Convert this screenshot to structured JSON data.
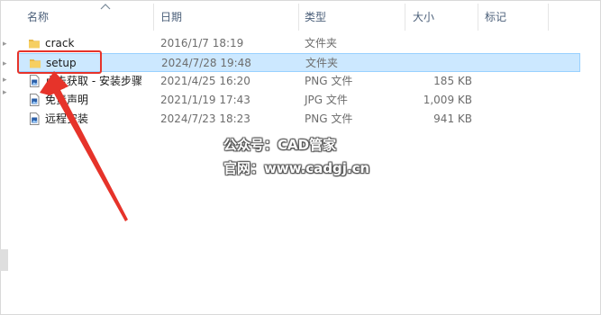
{
  "columns": {
    "name": "名称",
    "date": "日期",
    "type": "类型",
    "size": "大小",
    "tags": "标记"
  },
  "files": [
    {
      "name": "crack",
      "date": "2016/1/7 18:19",
      "type": "文件夹",
      "size": "",
      "icon": "folder-icon"
    },
    {
      "name": "setup",
      "date": "2024/7/28 19:48",
      "type": "文件夹",
      "size": "",
      "icon": "folder-icon",
      "selected": true
    },
    {
      "name": "点击获取 - 安装步骤",
      "date": "2021/4/25 16:20",
      "type": "PNG 文件",
      "size": "185 KB",
      "icon": "image-file-icon"
    },
    {
      "name": "免责声明",
      "date": "2021/1/19 17:43",
      "type": "JPG 文件",
      "size": "1,009 KB",
      "icon": "image-file-icon"
    },
    {
      "name": "远程安装",
      "date": "2024/7/23 18:23",
      "type": "PNG 文件",
      "size": "941 KB",
      "icon": "image-file-icon"
    }
  ],
  "watermark": {
    "line1": "公众号：CAD管家",
    "line2": "官网：www.cadgj.cn"
  },
  "colors": {
    "selection_bg": "#cce8ff",
    "selection_border": "#99d1ff",
    "annotation_red": "#e6332a",
    "folder_yellow": "#f6cf61"
  }
}
